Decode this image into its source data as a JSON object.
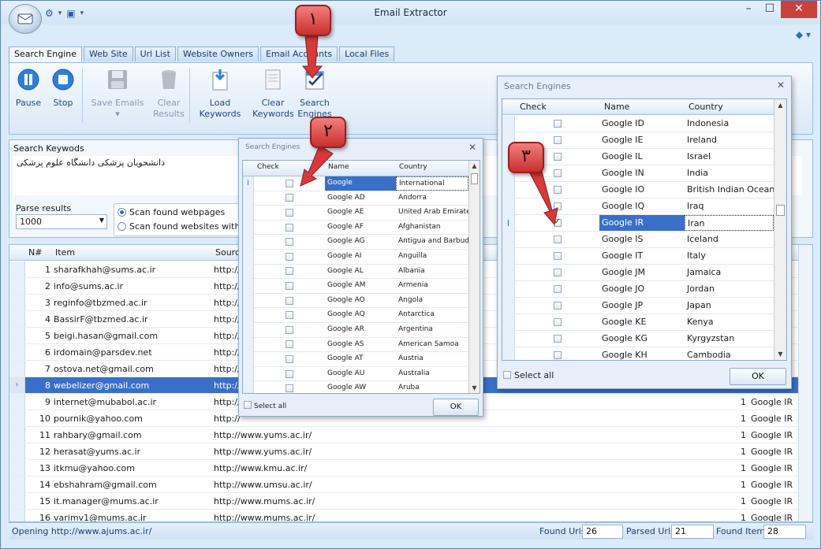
{
  "window": {
    "title": "Email Extractor",
    "min": "–",
    "max": "☐",
    "close": "✕"
  },
  "qat": {
    "gear": "⚙",
    "drop": "▾",
    "monitor": "▣"
  },
  "tabs": [
    "Search Engine",
    "Web Site",
    "Url List",
    "Website Owners",
    "Email Accounts",
    "Local Files"
  ],
  "ribbon": {
    "pause": "Pause",
    "stop": "Stop",
    "save_emails": "Save Emails ▾",
    "clear_results_1": "Clear",
    "clear_results_2": "Results",
    "load_keywords_1": "Load Keywords",
    "clear_keywords_1": "Clear",
    "clear_keywords_2": "Keywords",
    "search_engines_1": "Search",
    "search_engines_2": "Engines"
  },
  "keywords": {
    "label": "Search Keywods",
    "value": "دانشجویان پزشکی دانشگاه علوم پزشکی"
  },
  "parse": {
    "label": "Parse results",
    "value": "1000",
    "radio1": "Scan found webpages",
    "radio2": "Scan found websites with dep"
  },
  "grid": {
    "headers": {
      "num": "N#",
      "item": "Item",
      "source": "Source"
    },
    "rows": [
      {
        "n": "1",
        "item": "sharafkhah@sums.ac.ir",
        "src": "http://",
        "cnt": "",
        "eng": ""
      },
      {
        "n": "2",
        "item": "info@sums.ac.ir",
        "src": "http://",
        "cnt": "",
        "eng": ""
      },
      {
        "n": "3",
        "item": "reginfo@tbzmed.ac.ir",
        "src": "http://",
        "cnt": "",
        "eng": ""
      },
      {
        "n": "4",
        "item": "BassirF@tbzmed.ac.ir",
        "src": "http://",
        "cnt": "",
        "eng": ""
      },
      {
        "n": "5",
        "item": "beigi.hasan@gmail.com",
        "src": "http://",
        "cnt": "",
        "eng": ""
      },
      {
        "n": "6",
        "item": "irdomain@parsdev.net",
        "src": "http://",
        "cnt": "",
        "eng": ""
      },
      {
        "n": "7",
        "item": "ostova.net@gmail.com",
        "src": "http://",
        "cnt": "",
        "eng": ""
      },
      {
        "n": "8",
        "item": "webelizer@gmail.com",
        "src": "http://",
        "cnt": "",
        "eng": ""
      },
      {
        "n": "9",
        "item": "internet@mubabol.ac.ir",
        "src": "http://",
        "cnt": "1",
        "eng": "Google IR"
      },
      {
        "n": "10",
        "item": "pournik@yahoo.com",
        "src": "http://",
        "cnt": "1",
        "eng": "Google IR"
      },
      {
        "n": "11",
        "item": "rahbary@gmail.com",
        "src": "http://www.yums.ac.ir/",
        "cnt": "1",
        "eng": "Google IR"
      },
      {
        "n": "12",
        "item": "herasat@yums.ac.ir",
        "src": "http://www.yums.ac.ir/",
        "cnt": "1",
        "eng": "Google IR"
      },
      {
        "n": "13",
        "item": "itkmu@yahoo.com",
        "src": "http://www.kmu.ac.ir/",
        "cnt": "1",
        "eng": "Google IR"
      },
      {
        "n": "14",
        "item": "ebshahram@gmail.com",
        "src": "http://www.umsu.ac.ir/",
        "cnt": "1",
        "eng": "Google IR"
      },
      {
        "n": "15",
        "item": "it.manager@mums.ac.ir",
        "src": "http://www.mums.ac.ir/",
        "cnt": "1",
        "eng": "Google IR"
      },
      {
        "n": "16",
        "item": "varimv1@mums.ac.ir",
        "src": "http://www.mums.ac.ir/",
        "cnt": "1",
        "eng": "Google IR"
      }
    ]
  },
  "status": {
    "text": "Opening http://www.ajums.ac.ir/",
    "found_urls_label": "Found Urls",
    "found_urls": "26",
    "parsed_label": "Parsed Urls",
    "parsed": "21",
    "items_label": "Found Items",
    "items": "28"
  },
  "dialog_small": {
    "title": "Search Engines",
    "close": "✕",
    "headers": {
      "check": "Check",
      "name": "Name",
      "country": "Country"
    },
    "rows": [
      {
        "name": "Google",
        "country": "International"
      },
      {
        "name": "Google AD",
        "country": "Andorra"
      },
      {
        "name": "Google AE",
        "country": "United Arab Emirates"
      },
      {
        "name": "Google AF",
        "country": "Afghanistan"
      },
      {
        "name": "Google AG",
        "country": "Antigua and Barbuda"
      },
      {
        "name": "Google AI",
        "country": "Anguilla"
      },
      {
        "name": "Google AL",
        "country": "Albania"
      },
      {
        "name": "Google AM",
        "country": "Armenia"
      },
      {
        "name": "Google AO",
        "country": "Angola"
      },
      {
        "name": "Google AQ",
        "country": "Antarctica"
      },
      {
        "name": "Google AR",
        "country": "Argentina"
      },
      {
        "name": "Google AS",
        "country": "American Samoa"
      },
      {
        "name": "Google AT",
        "country": "Austria"
      },
      {
        "name": "Google AU",
        "country": "Australia"
      },
      {
        "name": "Google AW",
        "country": "Aruba"
      }
    ],
    "select_all": "Select all",
    "ok": "OK"
  },
  "dialog_large": {
    "title": "Search Engines",
    "close": "✕",
    "headers": {
      "check": "Check",
      "name": "Name",
      "country": "Country"
    },
    "rows": [
      {
        "name": "Google ID",
        "country": "Indonesia"
      },
      {
        "name": "Google IE",
        "country": "Ireland"
      },
      {
        "name": "Google IL",
        "country": "Israel"
      },
      {
        "name": "Google IN",
        "country": "India"
      },
      {
        "name": "Google IO",
        "country": "British Indian Ocean..."
      },
      {
        "name": "Google IQ",
        "country": "Iraq"
      },
      {
        "name": "Google IR",
        "country": "Iran"
      },
      {
        "name": "Google IS",
        "country": "Iceland"
      },
      {
        "name": "Google IT",
        "country": "Italy"
      },
      {
        "name": "Google JM",
        "country": "Jamaica"
      },
      {
        "name": "Google JO",
        "country": "Jordan"
      },
      {
        "name": "Google JP",
        "country": "Japan"
      },
      {
        "name": "Google KE",
        "country": "Kenya"
      },
      {
        "name": "Google KG",
        "country": "Kyrgyzstan"
      },
      {
        "name": "Google KH",
        "country": "Cambodia"
      }
    ],
    "select_all": "Select all",
    "ok": "OK"
  },
  "callouts": [
    "١",
    "٢",
    "٣"
  ]
}
